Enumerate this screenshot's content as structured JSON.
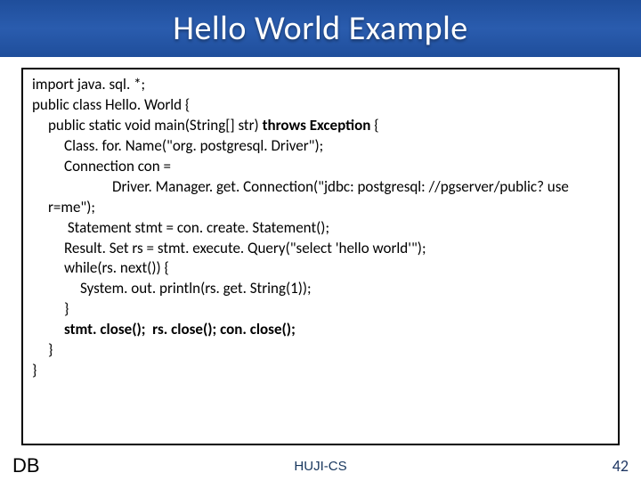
{
  "title": "Hello World Example",
  "code": [
    {
      "indent": 0,
      "html": "import java. sql. *;"
    },
    {
      "indent": 0,
      "html": "public class Hello. World {"
    },
    {
      "indent": 1,
      "html": "public static void main(String[] str) <b>throws Exception</b> {"
    },
    {
      "indent": 2,
      "html": "Class. for. Name(\"org. postgresql. Driver\");"
    },
    {
      "indent": 2,
      "html": "Connection con ="
    },
    {
      "indent": 4,
      "html": "Driver. Manager. get. Connection(\"jdbc: postgresql: //pgserver/public? use"
    },
    {
      "indent": 1,
      "html": "r=me\");"
    },
    {
      "indent": 2,
      "html": " Statement stmt = con. create. Statement();"
    },
    {
      "indent": 2,
      "html": "Result. Set rs = stmt. execute. Query(\"select 'hello world'\");"
    },
    {
      "indent": 2,
      "html": "while(rs. next()) {"
    },
    {
      "indent": 3,
      "html": "System. out. println(rs. get. String(1));"
    },
    {
      "indent": 2,
      "html": "}"
    },
    {
      "indent": 2,
      "html": "<b>stmt. close();  rs. close(); con. close();</b>"
    },
    {
      "indent": 1,
      "html": "}"
    },
    {
      "indent": 0,
      "html": "}"
    }
  ],
  "footer": {
    "left": "DB",
    "center": "HUJI-CS",
    "right": "42"
  }
}
